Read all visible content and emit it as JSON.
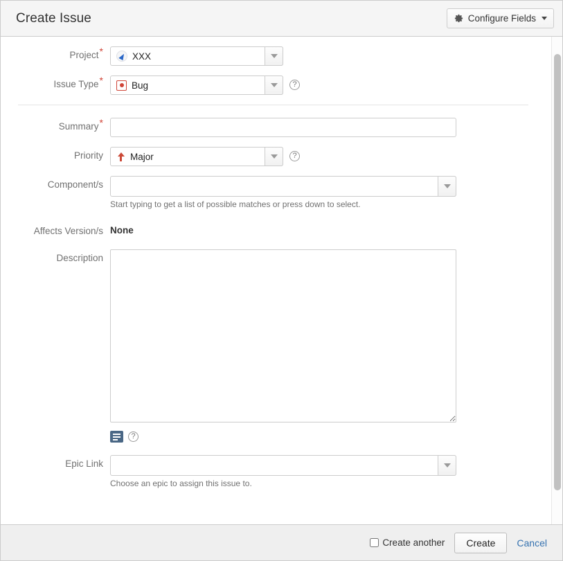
{
  "header": {
    "title": "Create Issue",
    "configure_fields_label": "Configure Fields",
    "gear_icon": "gear-icon",
    "caret_icon": "chevron-down-icon"
  },
  "form": {
    "project": {
      "label": "Project",
      "required": true,
      "value": "XXX",
      "icon": "project-avatar-icon"
    },
    "issue_type": {
      "label": "Issue Type",
      "required": true,
      "value": "Bug",
      "icon": "bug-icon",
      "help": "?"
    },
    "summary": {
      "label": "Summary",
      "required": true,
      "value": "",
      "placeholder": ""
    },
    "priority": {
      "label": "Priority",
      "required": false,
      "value": "Major",
      "icon": "priority-major-up-arrow-icon",
      "help": "?"
    },
    "components": {
      "label": "Component/s",
      "value": "",
      "placeholder": "",
      "hint": "Start typing to get a list of possible matches or press down to select."
    },
    "affects_versions": {
      "label": "Affects Version/s",
      "value": "None"
    },
    "description": {
      "label": "Description",
      "value": "",
      "placeholder": "",
      "wiki_button_icon": "wiki-markup-icon",
      "help": "?"
    },
    "epic_link": {
      "label": "Epic Link",
      "value": "",
      "placeholder": "",
      "hint": "Choose an epic to assign this issue to."
    }
  },
  "footer": {
    "create_another_label": "Create another",
    "create_another_checked": false,
    "create_label": "Create",
    "cancel_label": "Cancel"
  },
  "colors": {
    "required_star": "#d04437",
    "bug_red": "#d04437",
    "priority_red": "#cc4a38",
    "project_blue": "#2a67c7",
    "link_blue": "#3572b0",
    "wiki_button": "#4a6785",
    "header_bg": "#f5f5f5",
    "footer_bg": "#efefef"
  }
}
